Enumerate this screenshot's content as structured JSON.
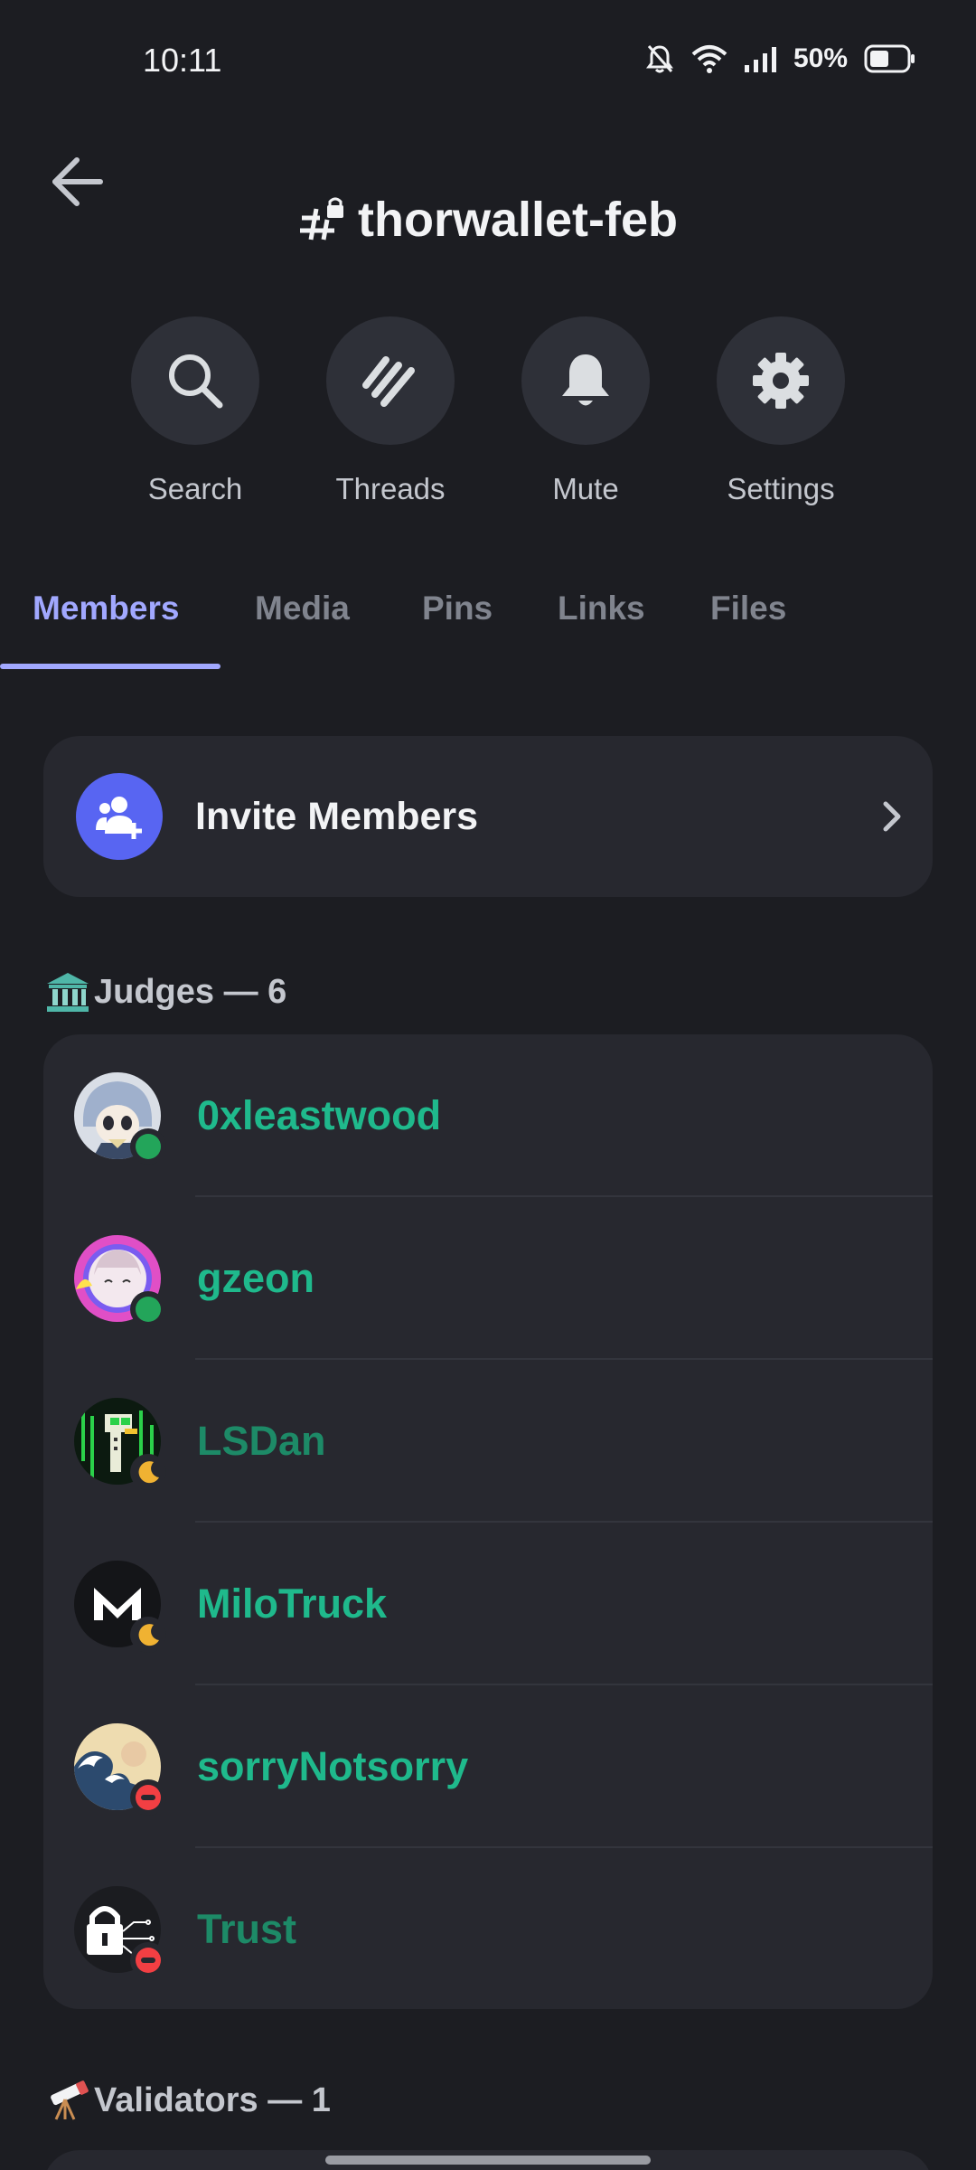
{
  "status_bar": {
    "time": "10:11",
    "battery": "50%"
  },
  "header": {
    "channel_name": "thorwallet-feb"
  },
  "actions": [
    {
      "label": "Search",
      "icon": "search-icon"
    },
    {
      "label": "Threads",
      "icon": "threads-icon"
    },
    {
      "label": "Mute",
      "icon": "bell-icon"
    },
    {
      "label": "Settings",
      "icon": "gear-icon"
    }
  ],
  "tabs": [
    {
      "label": "Members",
      "active": true
    },
    {
      "label": "Media",
      "active": false
    },
    {
      "label": "Pins",
      "active": false
    },
    {
      "label": "Links",
      "active": false
    },
    {
      "label": "Files",
      "active": false
    }
  ],
  "invite": {
    "label": "Invite Members"
  },
  "sections": [
    {
      "heading": "Judges — 6",
      "emoji": "classical-building-icon",
      "members": [
        {
          "name": "0xleastwood",
          "status": "online"
        },
        {
          "name": "gzeon",
          "status": "online"
        },
        {
          "name": "LSDan",
          "status": "idle"
        },
        {
          "name": "MiloTruck",
          "status": "idle"
        },
        {
          "name": "sorryNotsorry",
          "status": "dnd"
        },
        {
          "name": "Trust",
          "status": "dnd"
        }
      ]
    },
    {
      "heading": "Validators — 1",
      "emoji": "telescope-icon",
      "members": []
    }
  ],
  "colors": {
    "background": "#1c1d22",
    "card": "#27282f",
    "accent": "#a1a8ff",
    "blurple": "#5865f2",
    "member_name": "#1fb98c",
    "online": "#23a55a",
    "idle": "#f0b232",
    "dnd": "#f23f43"
  }
}
